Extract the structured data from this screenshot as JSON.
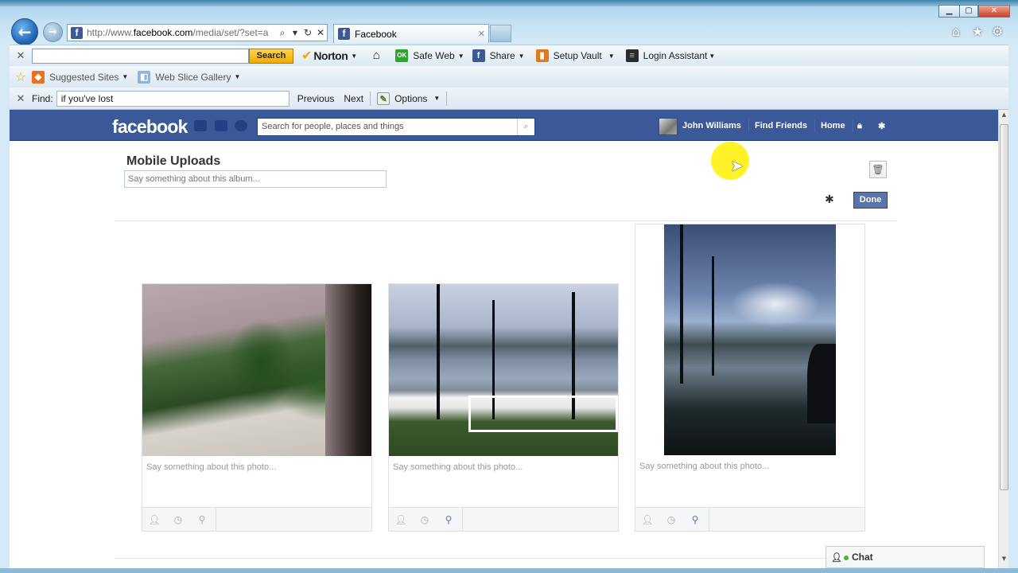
{
  "browser": {
    "address": "http://www.facebook.com/media/set/?set=a",
    "address_domain": "facebook.com",
    "tab_title": "Facebook",
    "search_button": "Search",
    "norton_label": "Norton",
    "safe_web_label": "Safe Web",
    "share_label": "Share",
    "setup_vault_label": "Setup Vault",
    "login_assistant_label": "Login Assistant",
    "suggested_sites_label": "Suggested Sites",
    "web_slice_label": "Web Slice Gallery",
    "find_label": "Find:",
    "find_value": "if you've lost",
    "previous_label": "Previous",
    "next_label": "Next",
    "options_label": "Options"
  },
  "facebook": {
    "logo": "facebook",
    "search_placeholder": "Search for people, places and things",
    "user_name": "John Williams",
    "find_friends": "Find Friends",
    "home": "Home"
  },
  "album": {
    "title": "Mobile Uploads",
    "description_placeholder": "Say something about this album...",
    "done_label": "Done",
    "photos": [
      {
        "caption_placeholder": "Say something about this photo..."
      },
      {
        "caption_placeholder": "Say something about this photo..."
      },
      {
        "caption_placeholder": "Say something about this photo..."
      }
    ]
  },
  "chat": {
    "label": "Chat"
  },
  "colors": {
    "facebook_blue": "#3b5998",
    "done_button": "#5b74a8",
    "norton_search": "#f2a900"
  }
}
